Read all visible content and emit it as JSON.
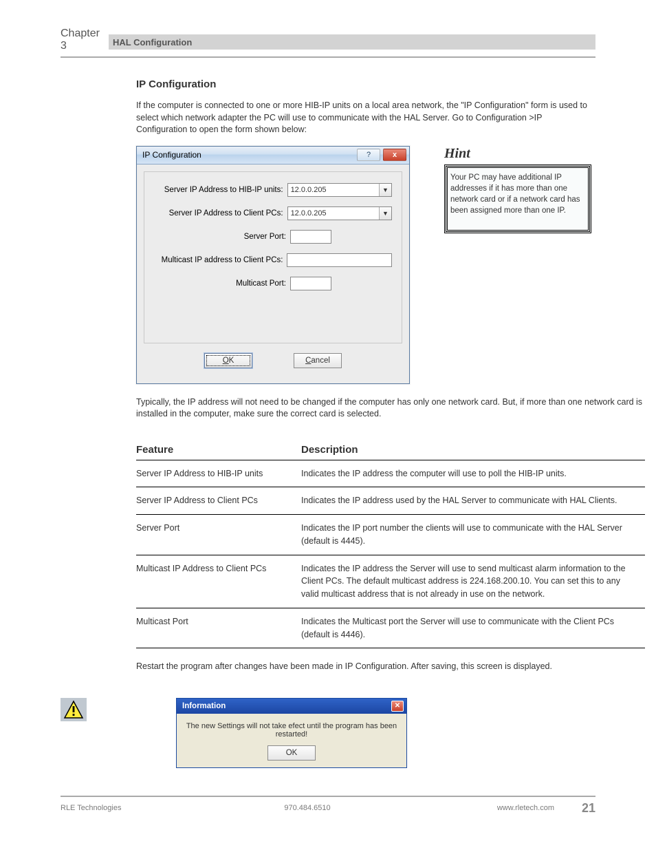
{
  "header": {
    "chapter": "Chapter 3",
    "title": "HAL Configuration"
  },
  "intro": {
    "heading": "IP Configuration",
    "text": "If the computer is connected to one or more HIB-IP units on a local area network, the \"IP Configuration\" form is used to select which network adapter the PC will use to communicate with the HAL Server. Go to Configuration >IP Configuration to open the form shown below:"
  },
  "dialog": {
    "title": "IP Configuration",
    "help_tooltip": "?",
    "close_tooltip": "x",
    "fields": {
      "server_ip_hib": {
        "label": "Server IP Address to HIB-IP units:",
        "value": "12.0.0.205"
      },
      "server_ip_clients": {
        "label": "Server IP Address to Client PCs:",
        "value": "12.0.0.205"
      },
      "server_port": {
        "label": "Server Port:",
        "value": ""
      },
      "multicast_ip": {
        "label": "Multicast IP address to Client PCs:",
        "value": ""
      },
      "multicast_port": {
        "label": "Multicast Port:",
        "value": ""
      }
    },
    "buttons": {
      "ok": "OK",
      "cancel": "Cancel"
    }
  },
  "hint": {
    "label": "Hint",
    "text": "Your PC may have additional IP addresses if it has more than one network card or if a network card has been assigned more than one IP."
  },
  "table": {
    "headers": {
      "col1": "Feature",
      "col2": "Description"
    },
    "rows": [
      {
        "feature": "Server IP Address to HIB-IP units",
        "description": "Indicates the IP address the computer will use to poll the HIB-IP units."
      },
      {
        "feature": "Server IP Address to Client PCs",
        "description": "Indicates the IP address used by the HAL Server to communicate with HAL Clients."
      },
      {
        "feature": "Server Port",
        "description": "Indicates the IP port number the clients will use to communicate with the HAL Server (default is 4445)."
      },
      {
        "feature": "Multicast IP Address to Client PCs",
        "description": "Indicates the IP address the Server will use to send multicast alarm information to the Client PCs. The default multicast address is 224.168.200.10. You can set this to any valid multicast address that is not already in use on the network."
      },
      {
        "feature": "Multicast Port",
        "description": "Indicates the Multicast port the Server will use to communicate with the Client PCs (default is 4446)."
      }
    ]
  },
  "info_dialog": {
    "title": "Information",
    "message": "The new Settings will not take efect until the program has been restarted!",
    "ok": "OK"
  },
  "closing": "Typically, the IP address will not need to be changed if the computer has only one network card. But, if more than one network card is installed in the computer, make sure the correct card is selected.",
  "closing2": "Restart the program after changes have been made in IP Configuration. After saving, this screen is displayed.",
  "footer": {
    "left": "RLE Technologies",
    "center": "970.484.6510",
    "right_a": "www.rletech.com",
    "page": "21"
  }
}
